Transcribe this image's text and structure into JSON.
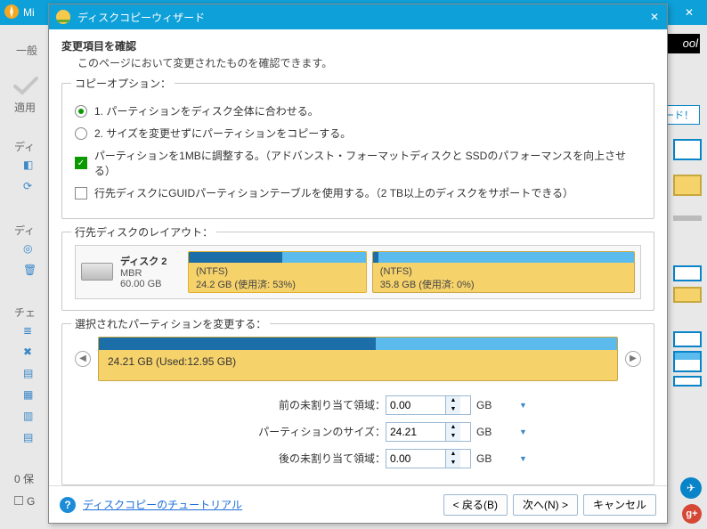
{
  "back_window": {
    "title_fragment": "Mi",
    "general_tab": "一般",
    "apply_label": "適用",
    "section_disk_prefix": "ディ",
    "section_check_prefix": "チェ",
    "tool_logo": "ool",
    "wizard_suffix": "ード！",
    "pending_text": "0 保",
    "gpt_prefix": "G"
  },
  "dialog": {
    "title": "ディスクコピーウィザード",
    "confirm_heading": "変更項目を確認",
    "confirm_sub": "このページにおいて変更されたものを確認できます。"
  },
  "copy_options": {
    "legend": "コピーオプション：",
    "opt1": "1. パーティションをディスク全体に合わせる。",
    "opt2": "2. サイズを変更せずにパーティションをコピーする。",
    "chk_align": "パーティションを1MBに調整する。（アドバンスト・フォーマットディスクと SSDのパフォーマンスを向上させる）",
    "chk_guid": "行先ディスクにGUIDパーティションテーブルを使用する。（2 TB以上のディスクをサポートできる）",
    "selected_radio": 1,
    "align_checked": true,
    "guid_checked": false
  },
  "dest_layout": {
    "legend": "行先ディスクのレイアウト：",
    "disk": {
      "name": "ディスク 2",
      "scheme": "MBR",
      "size": "60.00 GB"
    },
    "partitions": [
      {
        "fs": "(NTFS)",
        "detail": "24.2 GB (使用済: 53%)",
        "used_frac": 0.53,
        "width_frac": 0.4,
        "selected": true
      },
      {
        "fs": "(NTFS)",
        "detail": "35.8 GB (使用済: 0%)",
        "used_frac": 0.02,
        "width_frac": 0.6,
        "selected": false
      }
    ]
  },
  "edit_partition": {
    "legend": "選択されたパーティションを変更する：",
    "bar_label": "24.21 GB (Used:12.95 GB)",
    "used_frac": 0.535,
    "fields": {
      "before_label": "前の未割り当て領域：",
      "size_label": "パーティションのサイズ：",
      "after_label": "後の未割り当て領域：",
      "before_value": "0.00",
      "size_value": "24.21",
      "after_value": "0.00",
      "unit": "GB"
    }
  },
  "footer": {
    "tutorial_link": "ディスクコピーのチュートリアル",
    "back": "< 戻る(B)",
    "next": "次へ(N) >",
    "cancel": "キャンセル"
  }
}
